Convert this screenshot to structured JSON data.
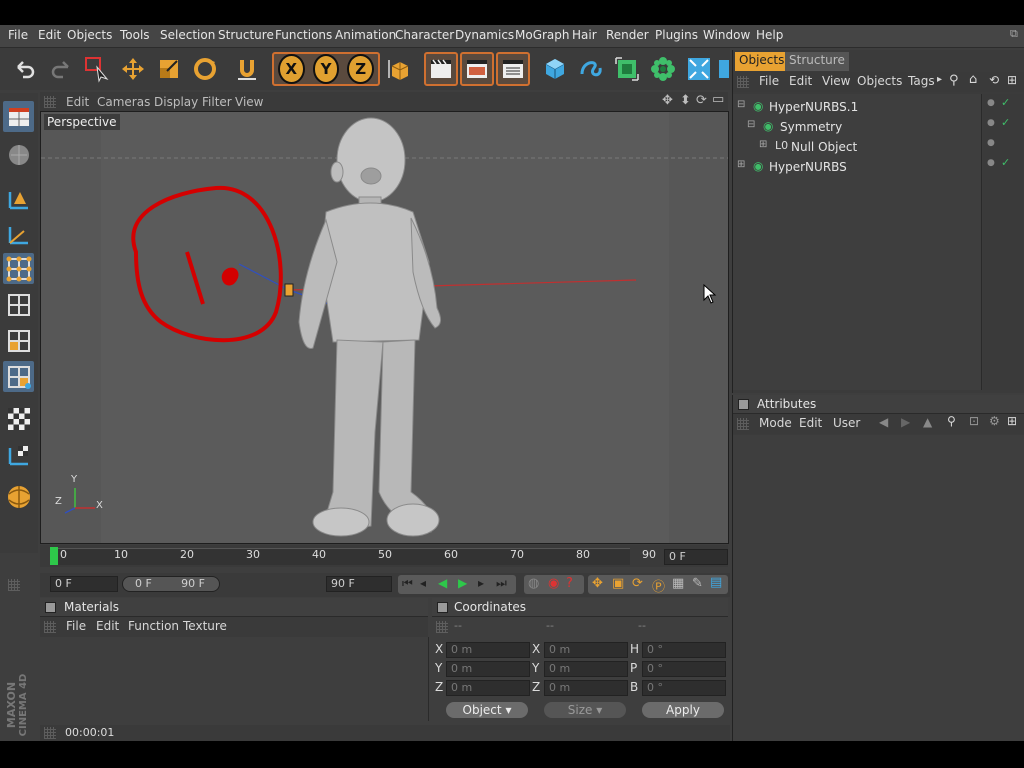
{
  "menubar": [
    "File",
    "Edit",
    "Objects",
    "Tools",
    "Selection",
    "Structure",
    "Functions",
    "Animation",
    "Character",
    "Dynamics",
    "MoGraph",
    "Hair",
    "Render",
    "Plugins",
    "Window",
    "Help"
  ],
  "toolbar": {
    "icons": [
      "undo-icon",
      "redo-icon",
      "live-selection-icon",
      "move-icon",
      "scale-icon",
      "rotate-icon",
      "magnet-icon",
      "x-axis-lock-icon",
      "y-axis-lock-icon",
      "z-axis-lock-icon",
      "world-coordinates-icon",
      "render-view-icon",
      "render-picture-viewer-icon",
      "render-settings-icon",
      "cube-icon",
      "spline-icon",
      "nurbs-icon",
      "array-icon",
      "deformer-icon"
    ],
    "axis_labels": [
      "X",
      "Y",
      "Z"
    ]
  },
  "viewport": {
    "menu": [
      "Edit",
      "Cameras",
      "Display",
      "Filter",
      "View"
    ],
    "label": "Perspective",
    "axis_gizmo": {
      "y": "Y",
      "z": "Z",
      "x": "X"
    }
  },
  "timeline": {
    "ticks": [
      "0",
      "10",
      "20",
      "30",
      "40",
      "50",
      "60",
      "70",
      "80",
      "90"
    ],
    "frame_field": "0 F",
    "current_frame": "0 F",
    "range_start": "0 F",
    "range_end": "90 F",
    "max_frame": "90 F"
  },
  "objects_panel": {
    "tabs": [
      "Objects",
      "Structure"
    ],
    "active_tab": "Objects",
    "menu": [
      "File",
      "Edit",
      "View",
      "Objects",
      "Tags"
    ],
    "items": [
      {
        "name": "HyperNURBS.1",
        "depth": 0,
        "expander": "minus"
      },
      {
        "name": "Symmetry",
        "depth": 1,
        "expander": "minus"
      },
      {
        "name": "Null Object",
        "depth": 2,
        "expander": "plus"
      },
      {
        "name": "HyperNURBS",
        "depth": 0,
        "expander": "plus"
      }
    ]
  },
  "attributes_panel": {
    "title": "Attributes",
    "menu": [
      "Mode",
      "Edit",
      "User"
    ]
  },
  "materials_panel": {
    "title": "Materials",
    "menu": [
      "File",
      "Edit",
      "Function",
      "Texture"
    ]
  },
  "coordinates_panel": {
    "title": "Coordinates",
    "headers": [
      "--",
      "--",
      "--"
    ],
    "rows": [
      {
        "a": "X",
        "a_val": "0 m",
        "b": "X",
        "b_val": "0 m",
        "c": "H",
        "c_val": "0 °"
      },
      {
        "a": "Y",
        "a_val": "0 m",
        "b": "Y",
        "b_val": "0 m",
        "c": "P",
        "c_val": "0 °"
      },
      {
        "a": "Z",
        "a_val": "0 m",
        "b": "Z",
        "b_val": "0 m",
        "c": "B",
        "c_val": "0 °"
      }
    ],
    "mode_select": "Object",
    "size_select": "Size",
    "apply_label": "Apply"
  },
  "status": {
    "time": "00:00:01"
  },
  "brand": {
    "line1": "MAXON",
    "line2": "CINEMA 4D"
  },
  "colors": {
    "accent_orange": "#e0a030",
    "annotation_red": "#d40000",
    "selected_blue": "#4d6a88"
  }
}
